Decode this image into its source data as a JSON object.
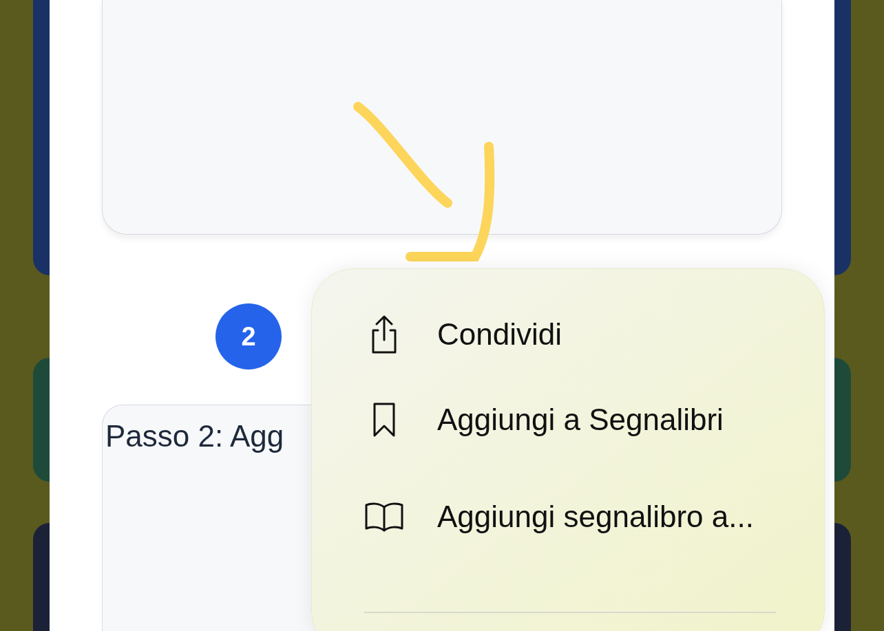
{
  "step": {
    "number": "2"
  },
  "step_card": {
    "title": "Passo 2: Agg"
  },
  "menu": {
    "items": [
      {
        "kind": "share",
        "label": "Condividi"
      },
      {
        "kind": "bookmark",
        "label": "Aggiungi a Segnalibri"
      },
      {
        "kind": "book",
        "label": "Aggiungi segnalibro a..."
      }
    ]
  }
}
